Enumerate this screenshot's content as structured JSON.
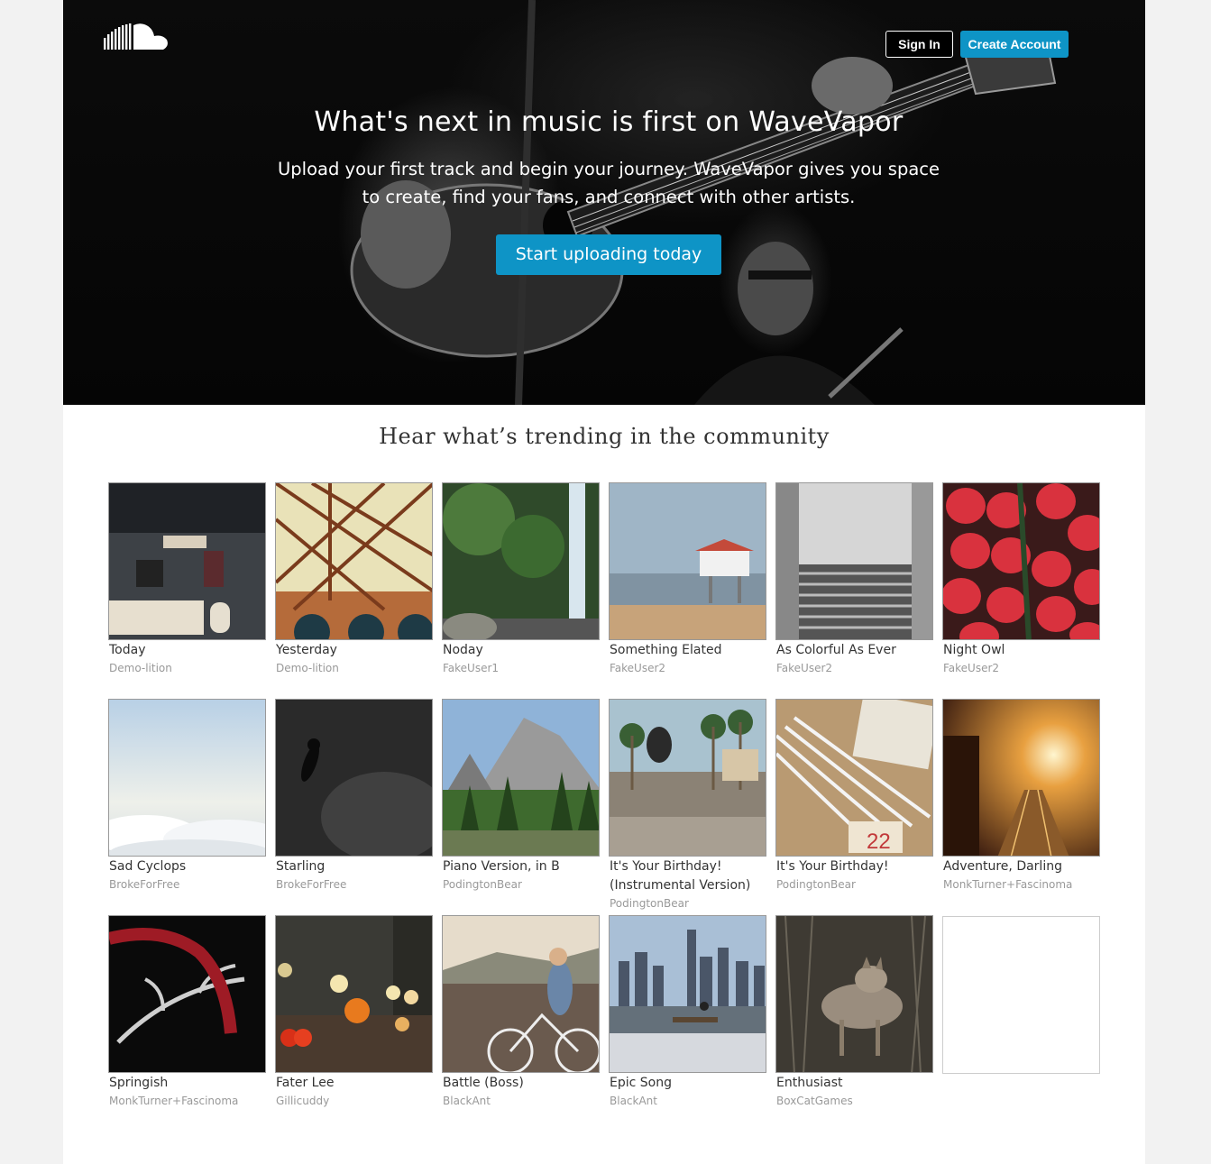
{
  "header": {
    "logo": "cloud-logo",
    "sign_in_label": "Sign In",
    "create_account_label": "Create Account"
  },
  "hero": {
    "title": "What's next in music is first on WaveVapor",
    "subtitle": "Upload your first track and begin your journey. WaveVapor gives you space to create, find your fans, and connect with other artists.",
    "cta_label": "Start uploading today"
  },
  "trending": {
    "heading": "Hear what’s trending in the community",
    "tracks": [
      {
        "title": "Today",
        "user": "Demo-lition"
      },
      {
        "title": "Yesterday",
        "user": "Demo-lition"
      },
      {
        "title": "Noday",
        "user": "FakeUser1"
      },
      {
        "title": "Something Elated",
        "user": "FakeUser2"
      },
      {
        "title": "As Colorful As Ever",
        "user": "FakeUser2"
      },
      {
        "title": "Night Owl",
        "user": "FakeUser2"
      },
      {
        "title": "Sad Cyclops",
        "user": "BrokeForFree"
      },
      {
        "title": "Starling",
        "user": "BrokeForFree"
      },
      {
        "title": "Piano Version, in B",
        "user": "PodingtonBear"
      },
      {
        "title": "It's Your Birthday! (Instrumental Version)",
        "user": "PodingtonBear"
      },
      {
        "title": "It's Your Birthday!",
        "user": "PodingtonBear"
      },
      {
        "title": "Adventure, Darling",
        "user": "MonkTurner+Fascinoma"
      },
      {
        "title": "Springish",
        "user": "MonkTurner+Fascinoma"
      },
      {
        "title": "Fater Lee",
        "user": "Gillicuddy"
      },
      {
        "title": "Battle (Boss)",
        "user": "BlackAnt"
      },
      {
        "title": "Epic Song",
        "user": "BlackAnt"
      },
      {
        "title": "Enthusiast",
        "user": "BoxCatGames"
      }
    ]
  }
}
